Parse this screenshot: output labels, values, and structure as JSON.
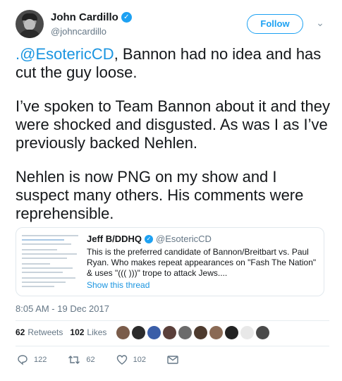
{
  "author": {
    "name": "John Cardillo",
    "handle": "@johncardillo",
    "verified_glyph": "✓"
  },
  "follow_label": "Follow",
  "caret_glyph": "⌄",
  "tweet": {
    "mention": ".@EsotericCD",
    "p1_rest": ", Bannon had no idea and has cut the guy loose.",
    "p2": "I’ve spoken to Team Bannon about it and they were shocked and disgusted. As was I as I’ve previously backed Nehlen.",
    "p3": "Nehlen is now PNG on my show and I suspect many others. His comments were reprehensible."
  },
  "quote": {
    "name": "Jeff B/DDHQ",
    "handle": "@EsotericCD",
    "body": "This is the preferred candidate of Bannon/Breitbart vs. Paul Ryan. Who makes repeat appearances on \"Fash The Nation\" & uses \"((( )))\" trope to attack Jews....",
    "link": "Show this thread"
  },
  "timestamp": "8:05 AM - 19 Dec 2017",
  "stats": {
    "retweets_count": "62",
    "retweets_label": "Retweets",
    "likes_count": "102",
    "likes_label": "Likes"
  },
  "likers": [
    "#7a5c4a",
    "#2b2b2b",
    "#3a5ea8",
    "#5a3f3a",
    "#6b6b6b",
    "#4d3a2e",
    "#8a6a55",
    "#222222",
    "#e8e8e8",
    "#4a4a4a"
  ],
  "actions": {
    "replies": "122",
    "retweets": "62",
    "likes": "102"
  },
  "colors": {
    "accent": "#1da1f2",
    "link": "#1b95e0",
    "muted": "#657786",
    "retweet_icon": "#17bf63"
  },
  "icons": [
    "verified-badge-icon",
    "chevron-down-icon",
    "reply-icon",
    "retweet-icon",
    "like-icon",
    "direct-message-icon"
  ]
}
